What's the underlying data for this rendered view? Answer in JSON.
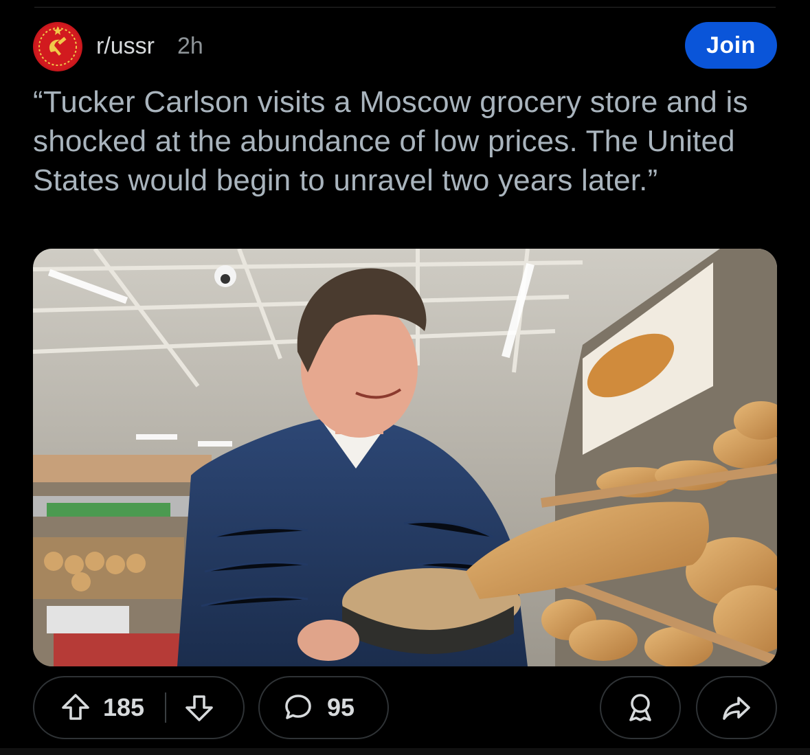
{
  "post": {
    "subreddit": "r/ussr",
    "age": "2h",
    "join_label": "Join",
    "title": "“Tucker Carlson visits a Moscow grocery store and is shocked at the abundance of low prices. The United States would begin to unravel two years later.”",
    "upvotes": "185",
    "comments": "95"
  },
  "icons": {
    "avatar": "hammer-sickle-emblem",
    "upvote": "arrow-up-icon",
    "downvote": "arrow-down-icon",
    "comment": "speech-bubble-icon",
    "award": "award-ribbon-icon",
    "share": "share-arrow-icon"
  },
  "colors": {
    "join_button": "#0a55d9",
    "background": "#000000",
    "title_text": "#a9b4bd",
    "avatar_red": "#c8161c"
  }
}
